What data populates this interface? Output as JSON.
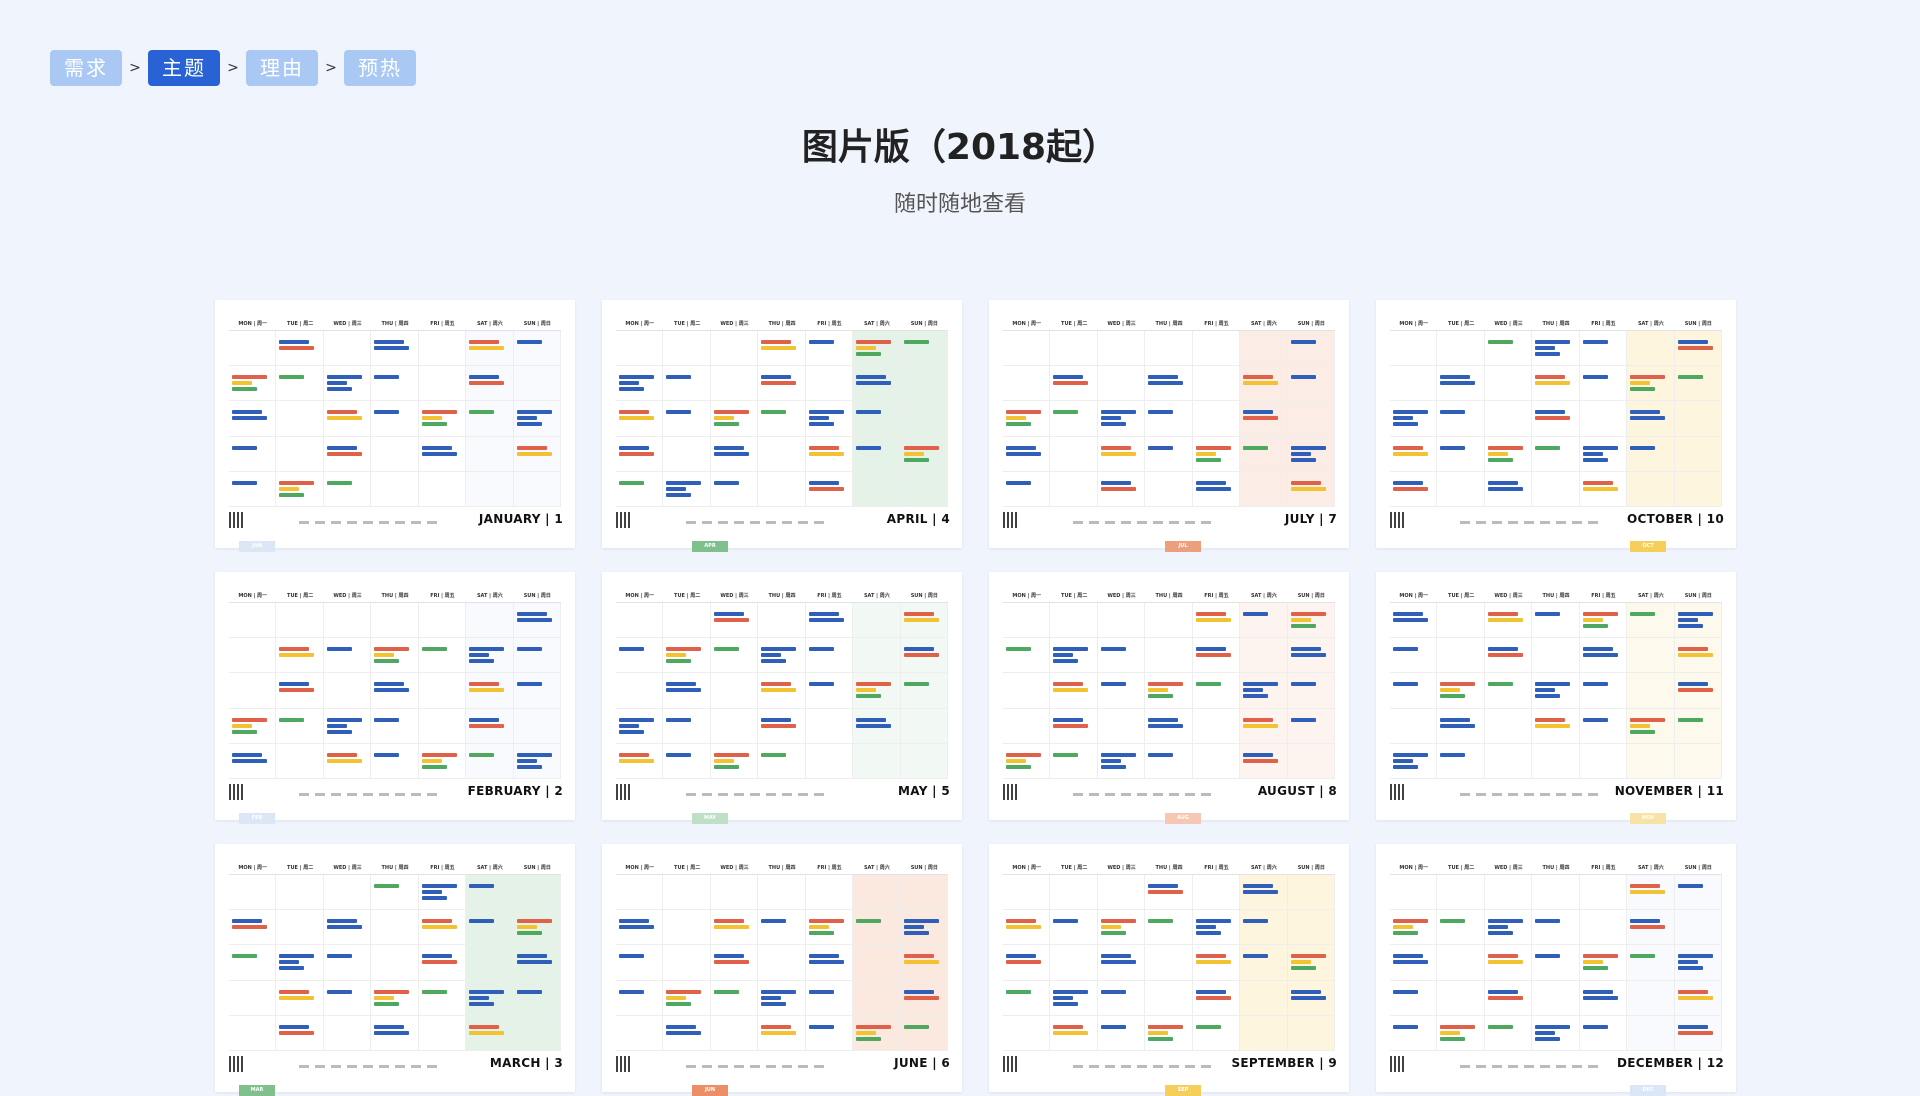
{
  "breadcrumb": [
    {
      "label": "需求",
      "active": false
    },
    {
      "label": "主题",
      "active": true
    },
    {
      "label": "理由",
      "active": false
    },
    {
      "label": "预热",
      "active": false
    }
  ],
  "breadcrumb_separator": ">",
  "title": "图片版（2018起）",
  "subtitle": "随时随地查看",
  "weekdays": [
    "MON | 周一",
    "TUE | 周二",
    "WED | 周三",
    "THU | 周四",
    "FRI | 周五",
    "SAT | 周六",
    "SUN | 周日"
  ],
  "calendars": [
    {
      "label": "JANUARY | 1",
      "tab": "JAN",
      "color": "#dbe7f7"
    },
    {
      "label": "APRIL | 4",
      "tab": "APR",
      "color": "#7fc08d"
    },
    {
      "label": "JULY | 7",
      "tab": "JUL",
      "color": "#ec9f7c"
    },
    {
      "label": "OCTOBER | 10",
      "tab": "OCT",
      "color": "#f5cf5a"
    },
    {
      "label": "FEBRUARY | 2",
      "tab": "FEB",
      "color": "#dbe7f7"
    },
    {
      "label": "MAY | 5",
      "tab": "MAY",
      "color": "#bfe0c6"
    },
    {
      "label": "AUGUST | 8",
      "tab": "AUG",
      "color": "#f6c7b2"
    },
    {
      "label": "NOVEMBER | 11",
      "tab": "NOV",
      "color": "#f8e3a6"
    },
    {
      "label": "MARCH | 3",
      "tab": "MAR",
      "color": "#7fc08d"
    },
    {
      "label": "JUNE | 6",
      "tab": "JUN",
      "color": "#ec8f66"
    },
    {
      "label": "SEPTEMBER | 9",
      "tab": "SEP",
      "color": "#f5cf5a"
    },
    {
      "label": "DECEMBER | 12",
      "tab": "DEC",
      "color": "#dbe7f7"
    }
  ]
}
